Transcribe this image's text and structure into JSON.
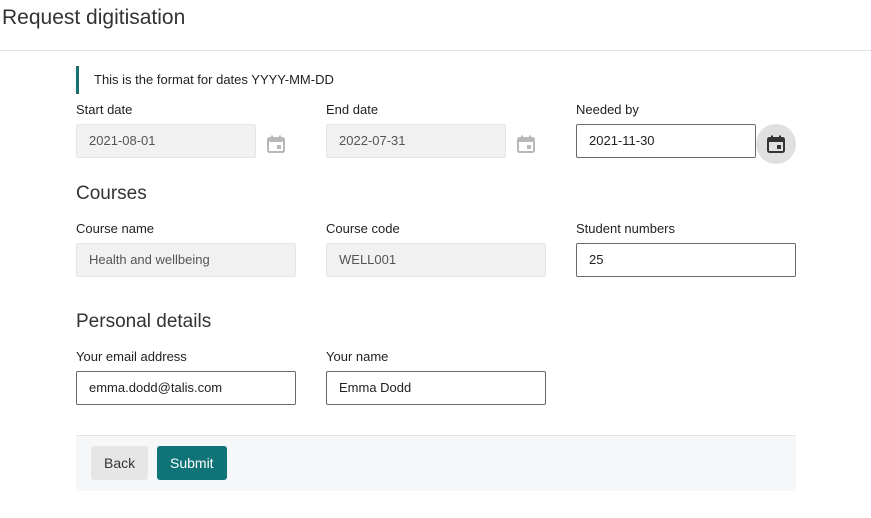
{
  "page": {
    "title": "Request digitisation"
  },
  "hint": {
    "text": "This is the format for dates YYYY-MM-DD"
  },
  "dates": {
    "start": {
      "label": "Start date",
      "value": "2021-08-01"
    },
    "end": {
      "label": "End date",
      "value": "2022-07-31"
    },
    "needed": {
      "label": "Needed by",
      "value": "2021-11-30"
    }
  },
  "courses": {
    "title": "Courses",
    "name": {
      "label": "Course name",
      "value": "Health and wellbeing"
    },
    "code": {
      "label": "Course code",
      "value": "WELL001"
    },
    "students": {
      "label": "Student numbers",
      "value": "25"
    }
  },
  "personal": {
    "title": "Personal details",
    "email": {
      "label": "Your email address",
      "value": "emma.dodd@talis.com"
    },
    "name": {
      "label": "Your name",
      "value": "Emma Dodd"
    }
  },
  "actions": {
    "back": "Back",
    "submit": "Submit"
  },
  "icons": {
    "calendar": "calendar-icon"
  },
  "colors": {
    "accent": "#0f7377",
    "hint_border": "#1a6f6f"
  }
}
